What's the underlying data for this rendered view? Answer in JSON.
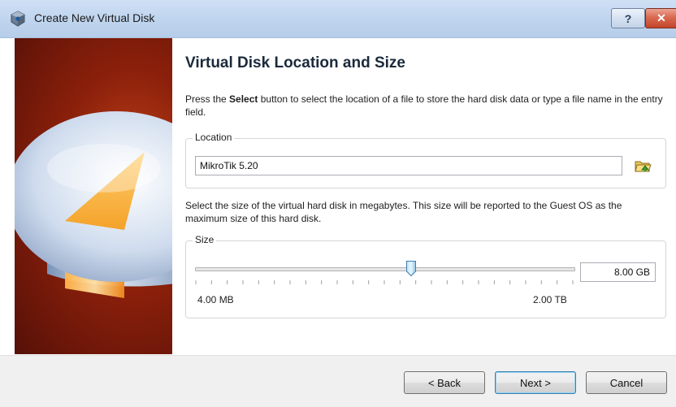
{
  "window": {
    "title": "Create New Virtual Disk",
    "help_label": "?",
    "close_label": "✕"
  },
  "page": {
    "heading": "Virtual Disk Location and Size",
    "intro_before": "Press the ",
    "intro_bold": "Select",
    "intro_after": " button to select the location of a file to store the hard disk data or type a file name in the entry field.",
    "size_description": "Select the size of the virtual hard disk in megabytes. This size will be reported to the Guest OS as the maximum size of this hard disk."
  },
  "location": {
    "legend": "Location",
    "value": "MikroTik 5.20"
  },
  "size": {
    "legend": "Size",
    "value": "8.00 GB",
    "min_label": "4.00 MB",
    "max_label": "2.00 TB",
    "slider_position": 0.57
  },
  "buttons": {
    "back": "< Back",
    "next": "Next >",
    "cancel": "Cancel"
  },
  "colors": {
    "accent_focus": "#3c7fb1",
    "banner_red": "#8b200b"
  },
  "icons": {
    "title": "virtualbox-icon",
    "folder": "folder-open-icon"
  }
}
